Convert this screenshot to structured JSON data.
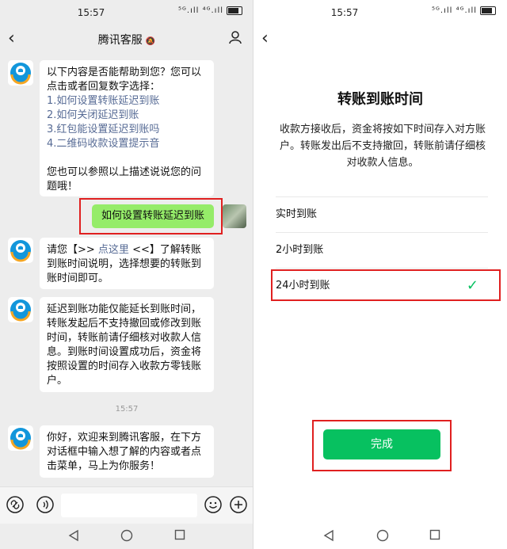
{
  "status": {
    "left_time": "15:57",
    "right_time": "15:57",
    "signal_text": "⁵ᴳ.ıll ⁴ᴳ.ıll"
  },
  "chat": {
    "title": "腾讯客服",
    "messages": [
      {
        "text": "以下内容是否能帮助到您？您可以点击或者回复数字选择：",
        "options": [
          "1.如何设置转账延迟到账",
          "2.如何关闭延迟到账",
          "3.红包能设置延迟到账吗",
          "4.二维码收款设置提示音"
        ],
        "footer": "您也可以参照以上描述说说您的问题哦！"
      }
    ],
    "user_message": "如何设置转账延迟到账",
    "reply1_prefix": "请您【>> ",
    "reply1_link": "点这里",
    "reply1_suffix": " <<】了解转账到账时间说明，选择想要的转账到账时间即可。",
    "reply2": "延迟到账功能仅能延长到账时间，转账发起后不支持撤回或修改到账时间，转账前请仔细核对收款人信息。到账时间设置成功后，资金将按照设置的时间存入收款方零钱账户。",
    "timestamp": "15:57",
    "greeting": "你好，欢迎来到腾讯客服，在下方对话框中输入想了解的内容或者点击菜单，马上为你服务！"
  },
  "settings": {
    "title": "转账到账时间",
    "description": "收款方接收后，资金将按如下时间存入对方账户。转账发出后不支持撤回，转账前请仔细核对收款人信息。",
    "options": [
      {
        "label": "实时到账",
        "selected": false
      },
      {
        "label": "2小时到账",
        "selected": false
      },
      {
        "label": "24小时到账",
        "selected": true
      }
    ],
    "done_label": "完成"
  },
  "colors": {
    "accent_green": "#07c160",
    "bubble_green": "#95ec69",
    "link_blue": "#576b95",
    "highlight_red": "#e02020"
  }
}
